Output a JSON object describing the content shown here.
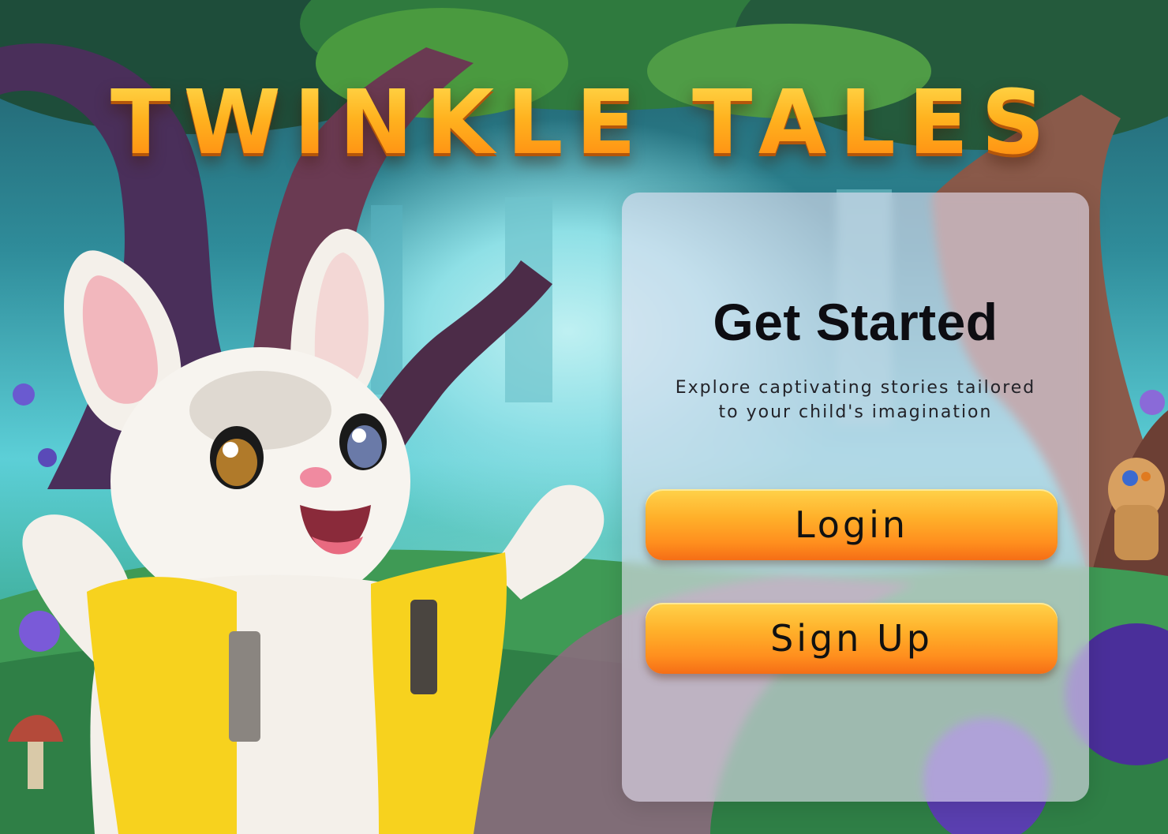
{
  "app": {
    "title": "TWINKLE TALES"
  },
  "panel": {
    "heading": "Get Started",
    "description_line1": "Explore captivating stories tailored",
    "description_line2": "to your child's imagination"
  },
  "buttons": {
    "login_label": "Login",
    "signup_label": "Sign Up"
  },
  "colors": {
    "title_gold": "#ffb21f",
    "button_orange": "#ff8f1e",
    "panel_tint": "#e4def0",
    "rabbit_jacket": "#f7d21e"
  },
  "illustration": {
    "character": "rabbit-mascot",
    "scene": "enchanted-forest"
  }
}
